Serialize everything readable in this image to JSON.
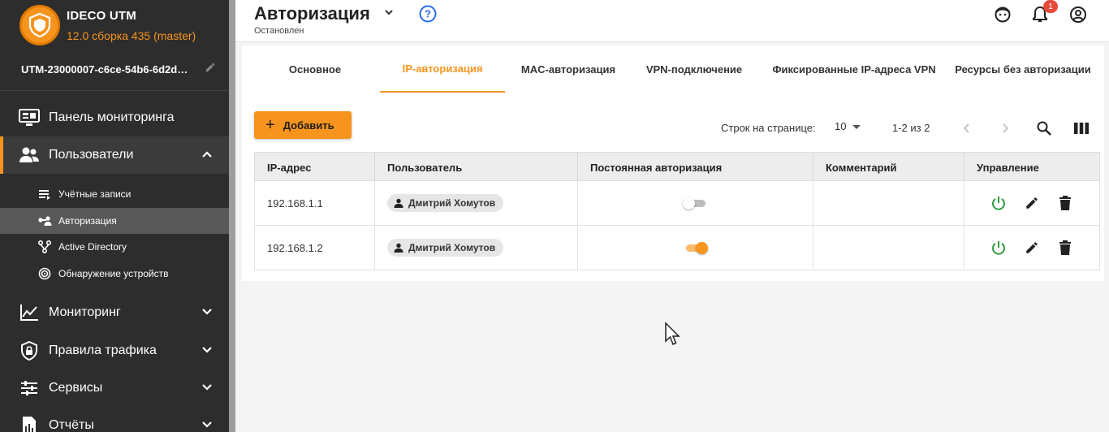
{
  "colors": {
    "accent": "#f7941d",
    "sidebar_bg": "#2d2d2d",
    "power_green": "#2e9c3f",
    "badge_red": "#e84a3a",
    "help_blue": "#2a6cf0"
  },
  "brand": {
    "name": "IDECO UTM",
    "build": "12.0 сборка 435 (master)",
    "logo_icon": "shield-icon"
  },
  "server": {
    "name": "UTM-23000007-c6ce-54b6-6d2d…",
    "edit_icon": "pencil-icon"
  },
  "sidebar": {
    "items": [
      {
        "label": "Панель мониторинга",
        "icon": "monitor-dashboard-icon"
      },
      {
        "label": "Пользователи",
        "icon": "users-icon",
        "expanded": true
      },
      {
        "label": "Мониторинг",
        "icon": "chart-line-icon"
      },
      {
        "label": "Правила трафика",
        "icon": "shield-lock-icon"
      },
      {
        "label": "Сервисы",
        "icon": "sliders-icon"
      },
      {
        "label": "Отчёты",
        "icon": "report-icon"
      }
    ],
    "users_sub": [
      {
        "label": "Учётные записи",
        "icon": "list-icon"
      },
      {
        "label": "Авторизация",
        "icon": "user-key-icon",
        "active": true
      },
      {
        "label": "Active Directory",
        "icon": "ad-tree-icon"
      },
      {
        "label": "Обнаружение устройств",
        "icon": "radar-icon"
      }
    ]
  },
  "header": {
    "title": "Авторизация",
    "status": "Остановлен",
    "notifications_count": "1",
    "icons": [
      "chevron-down-icon",
      "help-icon",
      "support-icon",
      "bell-icon",
      "account-icon"
    ]
  },
  "tabs": [
    {
      "label": "Основное"
    },
    {
      "label": "IP-авторизация",
      "active": true
    },
    {
      "label": "MAC-авторизация"
    },
    {
      "label": "VPN-подключение"
    },
    {
      "label": "Фиксированные IP-адреса VPN"
    },
    {
      "label": "Ресурсы без авторизации"
    }
  ],
  "toolbar": {
    "add_label": "Добавить",
    "rows_per_page_label": "Строк на странице:",
    "rows_per_page_value": "10",
    "range": "1-2 из 2"
  },
  "table": {
    "columns": [
      "IP-адрес",
      "Пользователь",
      "Постоянная авторизация",
      "Комментарий",
      "Управление"
    ],
    "rows": [
      {
        "ip": "192.168.1.1",
        "user": "Дмитрий Хомутов",
        "permanent": false,
        "comment": ""
      },
      {
        "ip": "192.168.1.2",
        "user": "Дмитрий Хомутов",
        "permanent": true,
        "comment": ""
      }
    ]
  }
}
